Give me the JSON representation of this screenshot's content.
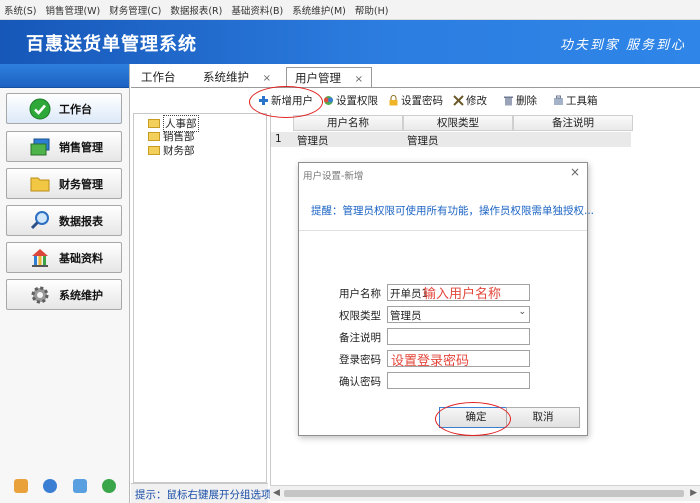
{
  "menu": [
    "系统(S)",
    "销售管理(W)",
    "财务管理(C)",
    "数据报表(R)",
    "基础资料(B)",
    "系统维护(M)",
    "帮助(H)"
  ],
  "app": {
    "title": "百惠送货单管理系统",
    "slogan": "功夫到家 服务到心"
  },
  "sidebar": {
    "items": [
      {
        "label": "工作台",
        "icon": "check-circle-icon"
      },
      {
        "label": "销售管理",
        "icon": "windows-icon"
      },
      {
        "label": "财务管理",
        "icon": "folder-icon"
      },
      {
        "label": "数据报表",
        "icon": "magnifier-icon"
      },
      {
        "label": "基础资料",
        "icon": "building-icon"
      },
      {
        "label": "系统维护",
        "icon": "gear-icon"
      }
    ]
  },
  "tabs": [
    {
      "label": "工作台"
    },
    {
      "label": "系统维护",
      "close": "×"
    },
    {
      "label": "用户管理",
      "close": "×"
    }
  ],
  "toolbar": {
    "add_user": "新增用户",
    "set_permission": "设置权限",
    "set_password": "设置密码",
    "modify": "修改",
    "delete": "删除",
    "toolbox": "工具箱"
  },
  "tree": {
    "nodes": [
      "人事部",
      "销售部",
      "财务部"
    ]
  },
  "hint": "提示：鼠标右键展开分组选项",
  "grid": {
    "columns": [
      "用户名称",
      "权限类型",
      "备注说明"
    ],
    "rows": [
      {
        "no": "1",
        "name": "管理员",
        "type": "管理员",
        "note": ""
      }
    ]
  },
  "dialog": {
    "title": "用户设置-新增",
    "close": "×",
    "tip": "提醒：管理员权限可使用所有功能，操作员权限需单独授权...",
    "fields": {
      "username_label": "用户名称",
      "username_value": "开单员1",
      "role_label": "权限类型",
      "role_value": "管理员",
      "note_label": "备注说明",
      "note_value": "",
      "password_label": "登录密码",
      "password_value": "",
      "confirm_label": "确认密码",
      "confirm_value": ""
    },
    "annotations": {
      "username_hint": "输入用户名称",
      "password_hint": "设置登录密码"
    },
    "ok_label": "确定",
    "cancel_label": "取消"
  },
  "colors": {
    "banner": "#1f6bd0",
    "annotation": "#e3473b",
    "tip": "#1c64c4"
  }
}
